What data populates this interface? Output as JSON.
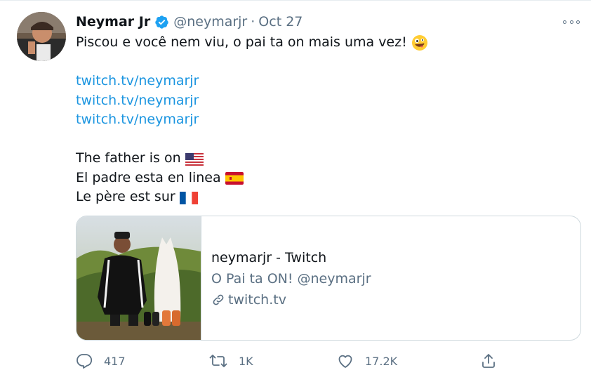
{
  "tweet": {
    "author_name": "Neymar Jr",
    "verified_icon": "verified-badge-icon",
    "handle": "@neymarjr",
    "separator": "·",
    "date": "Oct 27",
    "lines": {
      "l1": "Piscou e você nem viu, o pai ta on mais uma vez!",
      "link1": "twitch.tv/neymarjr",
      "link2": "twitch.tv/neymarjr",
      "link3": "twitch.tv/neymarjr",
      "en": "The father is on",
      "es": "El padre esta en linea",
      "fr": "Le père est sur"
    }
  },
  "card": {
    "title": "neymarjr - Twitch",
    "description": "O Pai ta ON! @neymarjr",
    "domain": "twitch.tv"
  },
  "actions": {
    "reply_count": "417",
    "retweet_count": "1K",
    "like_count": "17.2K"
  },
  "colors": {
    "link": "#1b95e0",
    "secondary": "#5b7083",
    "verified": "#1da1f2"
  }
}
